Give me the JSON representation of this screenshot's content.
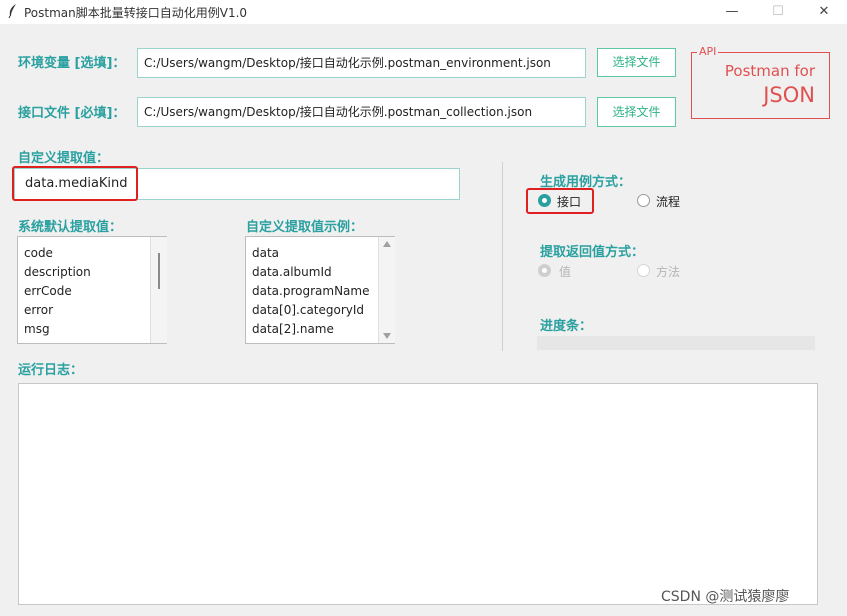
{
  "window": {
    "title": "Postman脚本批量转接口自动化用例V1.0",
    "minimize": "—",
    "maximize": "☐",
    "close": "✕"
  },
  "env": {
    "label": "环境变量 [选填]：",
    "value": "C:/Users/wangm/Desktop/接口自动化示例.postman_environment.json",
    "button": "选择文件"
  },
  "api_file": {
    "label": "接口文件 [必填]：",
    "value": "C:/Users/wangm/Desktop/接口自动化示例.postman_collection.json",
    "button": "选择文件"
  },
  "logo": {
    "badge": "API",
    "line1": "Postman for",
    "line2": "JSON"
  },
  "custom": {
    "label": "自定义提取值：",
    "value": "data.mediaKind"
  },
  "default_list": {
    "label": "系统默认提取值：",
    "items": [
      "code",
      "description",
      "errCode",
      "error",
      "msg"
    ]
  },
  "example_list": {
    "label": "自定义提取值示例：",
    "items": [
      "data",
      "data.albumId",
      "data.programName",
      "data[0].categoryId",
      "data[2].name"
    ]
  },
  "gen_mode": {
    "label": "生成用例方式：",
    "options": [
      "接口",
      "流程"
    ],
    "selected": "接口"
  },
  "return_mode": {
    "label": "提取返回值方式：",
    "options": [
      "值",
      "方法"
    ],
    "selected": "值"
  },
  "progress": {
    "label": "进度条：",
    "value": 0
  },
  "log": {
    "label": "运行日志：",
    "content": ""
  },
  "watermark": "CSDN @测试猿廖廖",
  "colors": {
    "accent": "#2aa0a0",
    "button": "#2bb386",
    "highlight": "#e02020",
    "logo": "#e05050"
  }
}
